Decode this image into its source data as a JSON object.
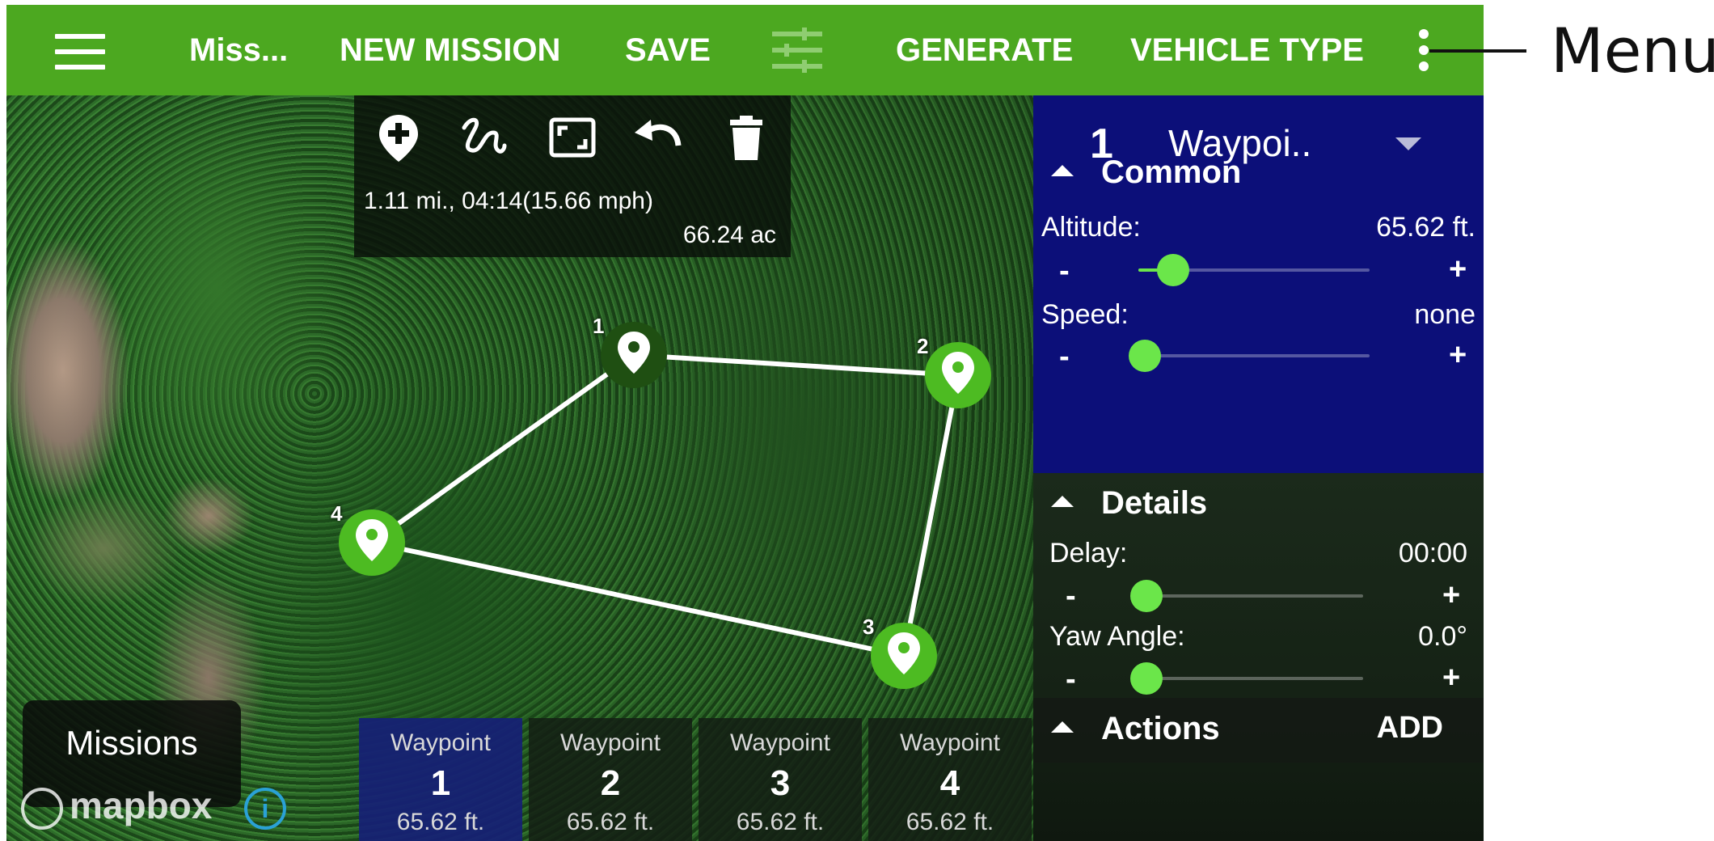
{
  "toolbar": {
    "title": "Miss...",
    "new_mission": "NEW MISSION",
    "save": "SAVE",
    "generate": "GENERATE",
    "vehicle_type": "VEHICLE TYPE",
    "icons": [
      "menu-icon",
      "sliders-icon",
      "more-vert-icon"
    ]
  },
  "map_tools": {
    "icons": [
      "add-location-icon",
      "freehand-draw-icon",
      "fit-bounds-icon",
      "undo-icon",
      "delete-icon"
    ],
    "stats": "1.11 mi., 04:14(15.66 mph)",
    "area": "66.24 ac"
  },
  "markers": [
    {
      "num": "1",
      "color": "#1f4f12"
    },
    {
      "num": "2",
      "color": "#4dbb22"
    },
    {
      "num": "3",
      "color": "#4dbb22"
    },
    {
      "num": "4",
      "color": "#4dbb22"
    }
  ],
  "missions_button": "Missions",
  "attribution": {
    "logo": "mapbox",
    "info": "i"
  },
  "waypoint_tabs": [
    {
      "label": "Waypoint",
      "number": "1",
      "altitude": "65.62 ft."
    },
    {
      "label": "Waypoint",
      "number": "2",
      "altitude": "65.62 ft."
    },
    {
      "label": "Waypoint",
      "number": "3",
      "altitude": "65.62 ft."
    },
    {
      "label": "Waypoint",
      "number": "4",
      "altitude": "65.62 ft."
    }
  ],
  "panel": {
    "index": "1",
    "type": "Waypoi..",
    "common": {
      "title": "Common",
      "altitude_label": "Altitude:",
      "altitude_value": "65.62 ft.",
      "altitude_level": 0.15,
      "speed_label": "Speed:",
      "speed_value": "none",
      "speed_level": 0.0
    },
    "details": {
      "title": "Details",
      "delay_label": "Delay:",
      "delay_value": "00:00",
      "delay_level": 0.0,
      "yaw_label": "Yaw Angle:",
      "yaw_value": "0.0°",
      "yaw_level": 0.0
    },
    "actions": {
      "title": "Actions",
      "add": "ADD"
    },
    "minus": "-",
    "plus": "+"
  },
  "callout": "Menu",
  "colors": {
    "toolbar": "#4ca820",
    "panel_blue": "#0c0f79",
    "accent": "#6be64a",
    "active_tab": "#161f76"
  }
}
